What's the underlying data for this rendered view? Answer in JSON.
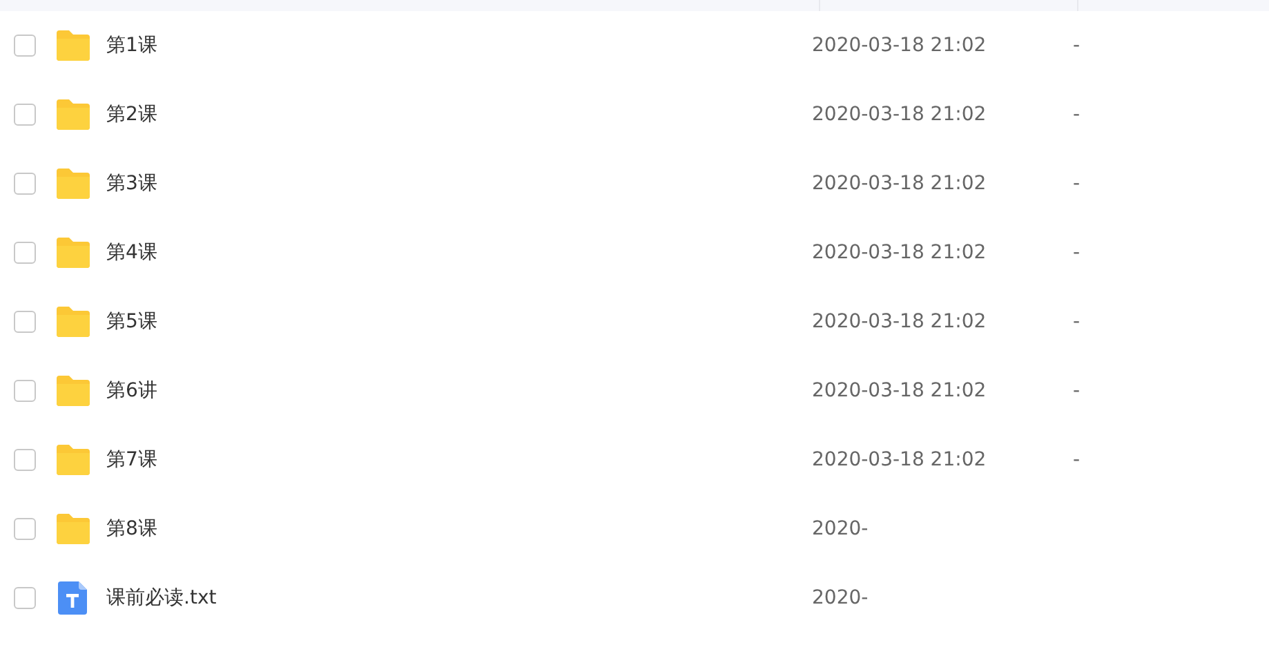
{
  "table": {
    "rows": [
      {
        "kind": "folder",
        "name": "第1课",
        "modified": "2020-03-18 21:02",
        "size": "-",
        "checked": false
      },
      {
        "kind": "folder",
        "name": "第2课",
        "modified": "2020-03-18 21:02",
        "size": "-",
        "checked": false
      },
      {
        "kind": "folder",
        "name": "第3课",
        "modified": "2020-03-18 21:02",
        "size": "-",
        "checked": false
      },
      {
        "kind": "folder",
        "name": "第4课",
        "modified": "2020-03-18 21:02",
        "size": "-",
        "checked": false
      },
      {
        "kind": "folder",
        "name": "第5课",
        "modified": "2020-03-18 21:02",
        "size": "-",
        "checked": false
      },
      {
        "kind": "folder",
        "name": "第6讲",
        "modified": "2020-03-18 21:02",
        "size": "-",
        "checked": false
      },
      {
        "kind": "folder",
        "name": "第7课",
        "modified": "2020-03-18 21:02",
        "size": "-",
        "checked": false
      },
      {
        "kind": "folder",
        "name": "第8课",
        "modified": "2020-",
        "checked": false
      },
      {
        "kind": "text-file",
        "name": "课前必读.txt",
        "modified": "2020-",
        "checked": false
      }
    ]
  }
}
